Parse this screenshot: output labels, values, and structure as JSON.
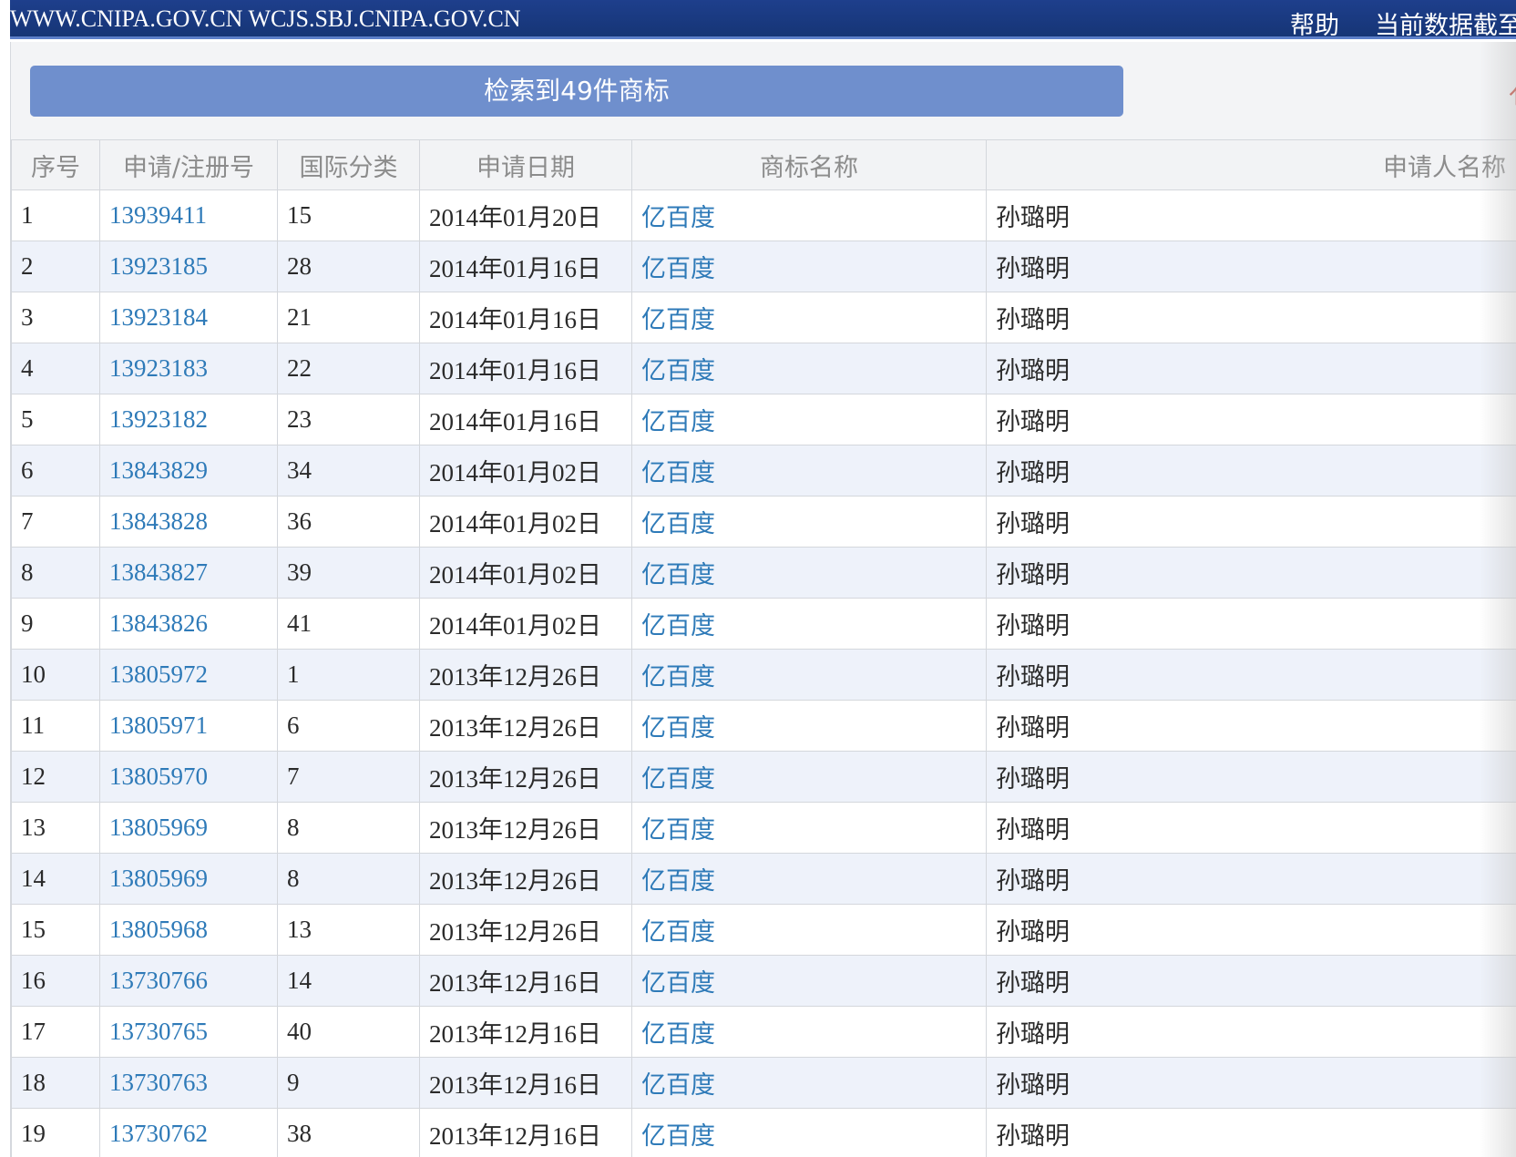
{
  "topbar": {
    "site": "WWW.CNIPA.GOV.CN WCJS.SBJ.CNIPA.GOV.CN",
    "help": "帮助",
    "cutoff": "当前数据截至"
  },
  "result_banner": "检索到49件商标",
  "red_fragment": "亻",
  "table": {
    "headers": [
      "序号",
      "申请/注册号",
      "国际分类",
      "申请日期",
      "商标名称",
      "申请人名称"
    ],
    "rows": [
      [
        "1",
        "13939411",
        "15",
        "2014年01月20日",
        "亿百度",
        "孙璐明"
      ],
      [
        "2",
        "13923185",
        "28",
        "2014年01月16日",
        "亿百度",
        "孙璐明"
      ],
      [
        "3",
        "13923184",
        "21",
        "2014年01月16日",
        "亿百度",
        "孙璐明"
      ],
      [
        "4",
        "13923183",
        "22",
        "2014年01月16日",
        "亿百度",
        "孙璐明"
      ],
      [
        "5",
        "13923182",
        "23",
        "2014年01月16日",
        "亿百度",
        "孙璐明"
      ],
      [
        "6",
        "13843829",
        "34",
        "2014年01月02日",
        "亿百度",
        "孙璐明"
      ],
      [
        "7",
        "13843828",
        "36",
        "2014年01月02日",
        "亿百度",
        "孙璐明"
      ],
      [
        "8",
        "13843827",
        "39",
        "2014年01月02日",
        "亿百度",
        "孙璐明"
      ],
      [
        "9",
        "13843826",
        "41",
        "2014年01月02日",
        "亿百度",
        "孙璐明"
      ],
      [
        "10",
        "13805972",
        "1",
        "2013年12月26日",
        "亿百度",
        "孙璐明"
      ],
      [
        "11",
        "13805971",
        "6",
        "2013年12月26日",
        "亿百度",
        "孙璐明"
      ],
      [
        "12",
        "13805970",
        "7",
        "2013年12月26日",
        "亿百度",
        "孙璐明"
      ],
      [
        "13",
        "13805969",
        "8",
        "2013年12月26日",
        "亿百度",
        "孙璐明"
      ],
      [
        "14",
        "13805969",
        "8",
        "2013年12月26日",
        "亿百度",
        "孙璐明"
      ],
      [
        "15",
        "13805968",
        "13",
        "2013年12月26日",
        "亿百度",
        "孙璐明"
      ],
      [
        "16",
        "13730766",
        "14",
        "2013年12月16日",
        "亿百度",
        "孙璐明"
      ],
      [
        "17",
        "13730765",
        "40",
        "2013年12月16日",
        "亿百度",
        "孙璐明"
      ],
      [
        "18",
        "13730763",
        "9",
        "2013年12月16日",
        "亿百度",
        "孙璐明"
      ],
      [
        "19",
        "13730762",
        "38",
        "2013年12月16日",
        "亿百度",
        "孙璐明"
      ]
    ]
  },
  "colors": {
    "topbar": "#1e3f8c",
    "banner": "#6f8fcd",
    "link": "#2e7ab8",
    "row_alt": "#eef2fa"
  }
}
